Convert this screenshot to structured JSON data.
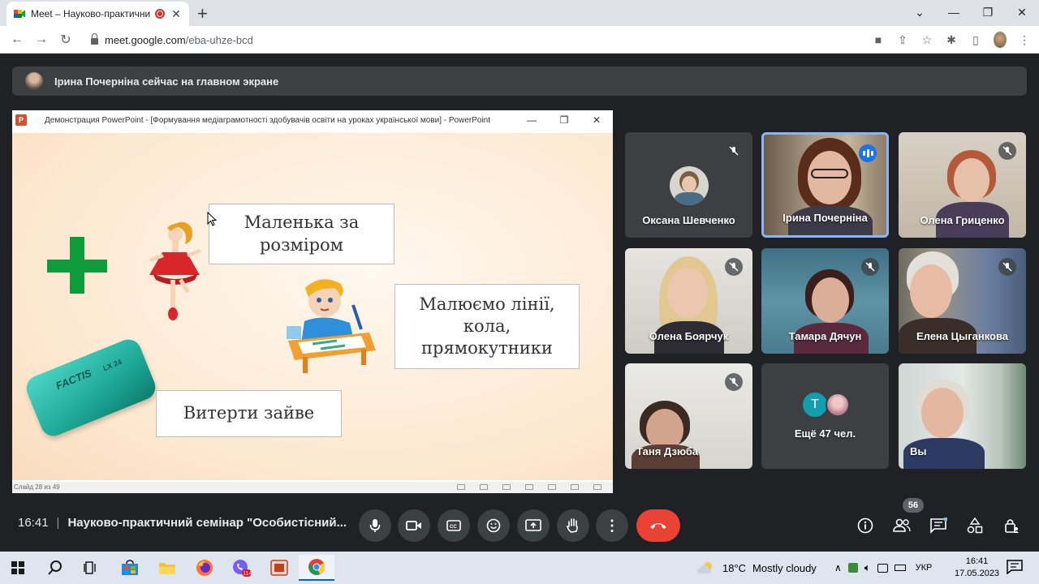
{
  "browser": {
    "tab_title": "Meet – Науково-практичний",
    "new_tab": "+",
    "url_host": "meet.google.com",
    "url_path": "/eba-uhze-bcd",
    "window_controls": [
      "⌄",
      "—",
      "❐",
      "✕"
    ]
  },
  "banner": {
    "text": "Ірина Почерніна сейчас на главном экране"
  },
  "presentation": {
    "window_title": "Демонстрация PowerPoint - [Формування медіаграмотності здобувачів освіти на уроках української мови] - PowerPoint",
    "slide_counter": "Слайд 28 из 49",
    "callout_1": "Маленька за розміром",
    "callout_2": "Малюємо лінії, кола, прямокутники",
    "callout_3": "Витерти зайве",
    "eraser_brand": "FACTIS",
    "eraser_model": "LX 24"
  },
  "participants": [
    {
      "name": "Оксана Шевченко",
      "muted": true
    },
    {
      "name": "Ірина Почерніна",
      "speaking": true
    },
    {
      "name": "Олена Гриценко",
      "muted": true
    },
    {
      "name": "Олена Боярчук",
      "muted": true
    },
    {
      "name": "Тамара Дячун",
      "muted": true
    },
    {
      "name": "Елена Цыганкова",
      "muted": true
    },
    {
      "name": "Таня Дзюба",
      "muted": true
    },
    {
      "name": "Ещё 47 чел.",
      "avatar_letter": "T"
    },
    {
      "name": "Вы"
    }
  ],
  "meeting": {
    "time": "16:41",
    "title": "Науково-практичний семінар \"Особистісний...",
    "people_count": "56"
  },
  "taskbar": {
    "weather_temp": "18°C",
    "weather_text": "Mostly cloudy",
    "language": "УКР",
    "clock_time": "16:41",
    "clock_date": "17.05.2023",
    "viber_badge": "114"
  },
  "colors": {
    "meet_bg": "#202124",
    "tile_bg": "#3c4043",
    "hangup": "#ea4335",
    "active_speaker": "#8ab4f8",
    "plus_green": "#0f9b3b"
  }
}
